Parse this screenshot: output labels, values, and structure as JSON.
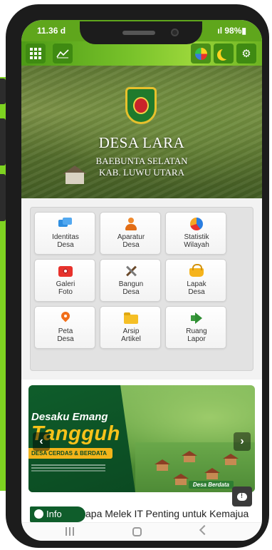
{
  "status_bar": {
    "time": "11.36 d",
    "battery": "ıl 98%▮"
  },
  "app_bar": {
    "menu_icon": "grid-menu-icon",
    "chart_icon": "line-chart-icon",
    "palette_icon": "color-palette-icon",
    "theme_icon": "moon-icon",
    "settings_icon": "gear-icon"
  },
  "hero": {
    "title": "DESA LARA",
    "subtitle_line1": "BAEBUNTA SELATAN",
    "subtitle_line2": "KAB. LUWU UTARA"
  },
  "menu": {
    "items": [
      {
        "line1": "Identitas",
        "line2": "Desa",
        "icon": "chat-bubbles-icon"
      },
      {
        "line1": "Aparatur",
        "line2": "Desa",
        "icon": "person-icon"
      },
      {
        "line1": "Statistik",
        "line2": "Wilayah",
        "icon": "pie-chart-icon"
      },
      {
        "line1": "Galeri",
        "line2": "Foto",
        "icon": "camera-icon"
      },
      {
        "line1": "Bangun",
        "line2": "Desa",
        "icon": "tools-icon"
      },
      {
        "line1": "Lapak",
        "line2": "Desa",
        "icon": "basket-icon"
      },
      {
        "line1": "Peta",
        "line2": "Desa",
        "icon": "map-pin-icon"
      },
      {
        "line1": "Arsip",
        "line2": "Artikel",
        "icon": "folder-icon"
      },
      {
        "line1": "Ruang",
        "line2": "Lapor",
        "icon": "megaphone-icon"
      }
    ]
  },
  "banner": {
    "title_line1": "Desaku Emang",
    "title_line2": "Tangguh",
    "ribbon": "DESA CERDAS & BERDATA",
    "caption": "Desa Berdata",
    "prev": "‹",
    "next": "›"
  },
  "ticker": {
    "badge": "Info",
    "text": "apa Melek IT Penting untuk Kemajua"
  },
  "colors": {
    "brand_green": "#5fa61c",
    "dark_green": "#0f5d2b",
    "accent_yellow": "#f7c21a"
  }
}
